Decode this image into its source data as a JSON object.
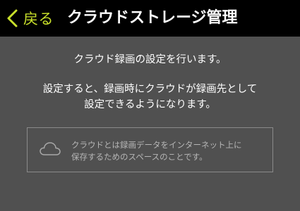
{
  "header": {
    "back_label": "戻る",
    "title": "クラウドストレージ管理"
  },
  "main": {
    "description_line1": "クラウド録画の設定を行います。",
    "description_line2": "設定すると、録画時にクラウドが録画先として",
    "description_line3": "設定できるようになります。",
    "info_line1": "クラウドとは録画データをインターネット上に",
    "info_line2": "保存するためのスペースのことです。"
  },
  "icons": {
    "back": "chevron-left-icon",
    "info": "cloud-icon"
  },
  "colors": {
    "header_bg": "#000000",
    "accent": "#c9e02b",
    "body_bg": "#505050",
    "text": "#ffffff",
    "info_text": "#b6b6b6",
    "info_border": "#8a8a8a"
  }
}
